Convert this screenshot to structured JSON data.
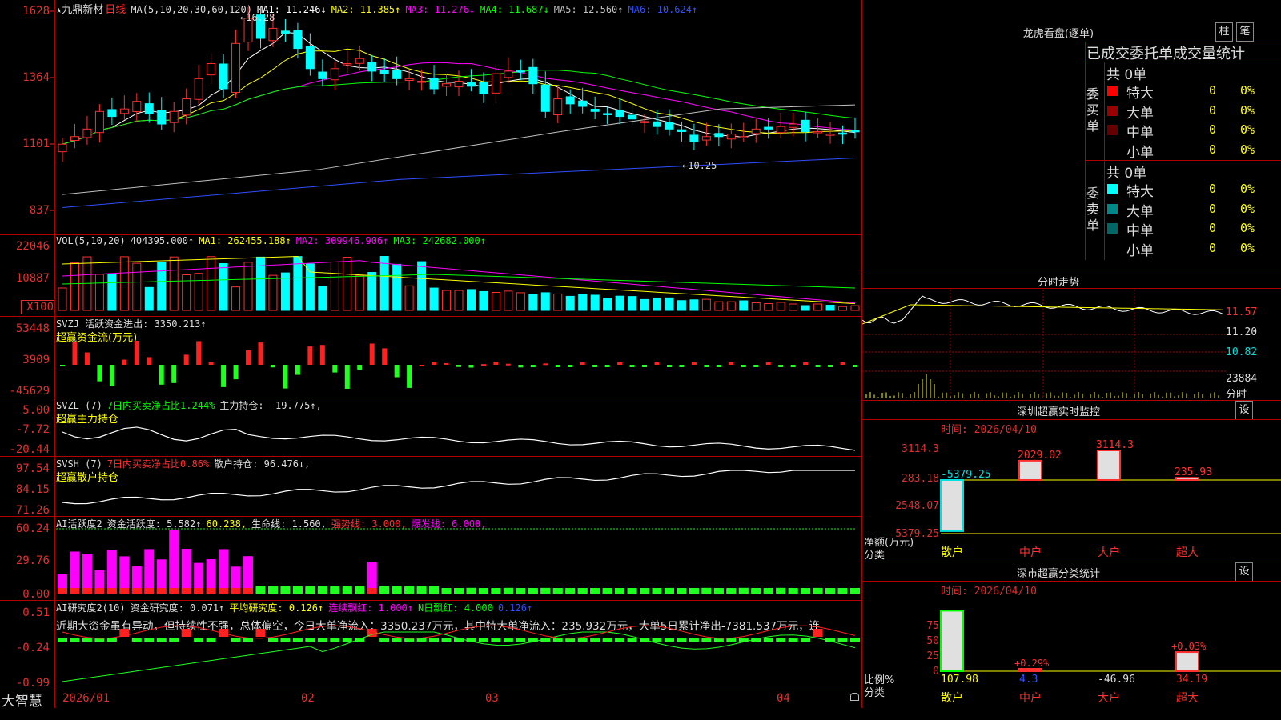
{
  "stock": {
    "name": "九鼎新材",
    "period": "日线"
  },
  "main_panel": {
    "ma_label": "MA(5,10,20,30,60,120)",
    "ma_values": [
      {
        "label": "MA1:",
        "value": "11.246↓",
        "color": "#ffffff"
      },
      {
        "label": "MA2:",
        "value": "11.385↑",
        "color": "#ffff00"
      },
      {
        "label": "MA3:",
        "value": "11.276↓",
        "color": "#ff00ff"
      },
      {
        "label": "MA4:",
        "value": "11.687↓",
        "color": "#00ff00"
      },
      {
        "label": "MA5:",
        "value": "12.560↑",
        "color": "#c0c0c0"
      },
      {
        "label": "MA6:",
        "value": "10.624↑",
        "color": "#2f4fff"
      }
    ],
    "y_ticks": [
      "1628",
      "1364",
      "1101",
      "837"
    ],
    "high_label": "16.28",
    "low_label": "10.25"
  },
  "vol_panel": {
    "label": "VOL(5,10,20)",
    "value": "404395.000↑",
    "ma1": "MA1: 262455.188↑",
    "ma2": "MA2: 309946.906↑",
    "ma3": "MA3: 242682.000↑",
    "y_ticks": [
      "22046",
      "10887",
      "X100"
    ]
  },
  "svzj_panel": {
    "label": "SVZJ  活跃资金进出: 3350.213↑",
    "sub": "超赢资金流(万元)",
    "y_ticks": [
      "53448",
      "3909",
      "-45629"
    ]
  },
  "svzl_panel": {
    "label": "SVZL (7)",
    "ratio": "7日内买卖净占比1.244%",
    "hold": "主力持仓: -19.775↑,",
    "sub": "超赢主力持仓",
    "y_ticks": [
      "5.00",
      "-7.72",
      "-20.44"
    ]
  },
  "svsh_panel": {
    "label": "SVSH (7)",
    "ratio": "7日内买卖净占比0.86%",
    "hold": "散户持仓: 96.476↓,",
    "sub": "超赢散户持仓",
    "y_ticks": [
      "97.54",
      "84.15",
      "71.26"
    ]
  },
  "ai1_panel": {
    "label": "AI活跃度2",
    "act": "资金活跃度: 5.582↑",
    "v2": "60.238,",
    "life": "生命线: 1.560,",
    "strong": "强势线: 3.000,",
    "burst": "爆发线: 6.000,",
    "y_ticks": [
      "60.24",
      "29.76",
      "0.00"
    ]
  },
  "ai2_panel": {
    "label": "AI研究度2(10)",
    "res": "资金研究度: 0.071↑",
    "avg": "平均研究度: 0.126↑",
    "cont": "连续飘红: 1.000↑",
    "nday": "N日飘红: 4.000",
    "last": "0.126↑",
    "text": "近期大资金虽有异动，但持续性不强，总体偏空，今日大单净流入：3350.237万元，其中特大单净流入：235.932万元，大单5日累计净出-7381.537万元，连",
    "y_ticks": [
      "0.51",
      "-0.24",
      "-0.99"
    ]
  },
  "x_axis": [
    "2026/01",
    "02",
    "03",
    "04"
  ],
  "brand": "大智慧",
  "right_panel": {
    "lhb_title": "龙虎看盘(逐单)",
    "btn1": "柱",
    "btn2": "笔",
    "sub_title": "已成交委托单成交量统计",
    "buy_label": "委买单",
    "sell_label": "委卖单",
    "buy_total": "共 0单",
    "sell_total": "共 0单",
    "buy_rows": [
      {
        "name": "特大",
        "val": "0",
        "pct": "0%",
        "color": "#ff0000"
      },
      {
        "name": "大单",
        "val": "0",
        "pct": "0%",
        "color": "#990000"
      },
      {
        "name": "中单",
        "val": "0",
        "pct": "0%",
        "color": "#660000"
      },
      {
        "name": "小单",
        "val": "0",
        "pct": "0%",
        "color": "#000000"
      }
    ],
    "sell_rows": [
      {
        "name": "特大",
        "val": "0",
        "pct": "0%",
        "color": "#00ffff"
      },
      {
        "name": "大单",
        "val": "0",
        "pct": "0%",
        "color": "#008888"
      },
      {
        "name": "中单",
        "val": "0",
        "pct": "0%",
        "color": "#006666"
      },
      {
        "name": "小单",
        "val": "0",
        "pct": "0%",
        "color": "#000000"
      }
    ],
    "fs_title": "分时走势",
    "fs_prices": [
      "11.57",
      "11.20",
      "10.82"
    ],
    "fs_vol": "23884",
    "fs_vol_label": "分时",
    "sz1_title": "深圳超赢实时监控",
    "set1": "设",
    "sz1_time": "时间: 2026/04/10",
    "sz1_y": [
      "3114.3",
      "283.18",
      "-2548.07",
      "-5379.25"
    ],
    "sz1_unit": "净额(万元)",
    "sz1_cat": "分类",
    "sz2_title": "深市超赢分类统计",
    "set2": "设",
    "sz2_time": "时间: 2026/04/10",
    "sz2_y": [
      "75",
      "50",
      "25",
      "0"
    ],
    "sz2_unit": "比例%",
    "sz2_cat": "分类",
    "cats": [
      "散户",
      "中户",
      "大户",
      "超大"
    ]
  },
  "chart_data": [
    {
      "type": "candlestick",
      "title": "九鼎新材 日线",
      "y_ticks": [
        16.28,
        13.64,
        11.01,
        8.37
      ],
      "high": 16.28,
      "low": 10.25,
      "close_approx": [
        11.0,
        11.3,
        11.6,
        12.3,
        12.1,
        12.4,
        12.7,
        12.2,
        11.8,
        12.3,
        12.8,
        13.6,
        14.2,
        13.2,
        15.0,
        16.0,
        15.2,
        15.6,
        15.4,
        14.8,
        14.0,
        13.6,
        14.0,
        14.2,
        14.4,
        13.9,
        13.8,
        13.6,
        13.6,
        13.5,
        13.2,
        13.4,
        13.5,
        13.3,
        13.0,
        13.8,
        13.9,
        13.9,
        13.4,
        12.3,
        12.8,
        12.6,
        12.5,
        12.3,
        12.2,
        12.1,
        12.0,
        11.9,
        11.7,
        11.6,
        11.5,
        11.1,
        11.3,
        11.3,
        11.4,
        11.3,
        11.6,
        11.6,
        11.7,
        11.8,
        11.5,
        11.5,
        11.4,
        11.4,
        11.5
      ]
    },
    {
      "type": "bar",
      "title": "VOL(5,10,20)",
      "y_ticks": [
        22046,
        10887
      ],
      "unit": "X100"
    },
    {
      "type": "bar",
      "title": "SVZJ 活跃资金进出",
      "y_ticks": [
        53448,
        3909,
        -45629
      ],
      "last": 3350.213
    },
    {
      "type": "line",
      "title": "SVZL 主力持仓",
      "y_ticks": [
        5.0,
        -7.72,
        -20.44
      ],
      "last": -19.775
    },
    {
      "type": "line",
      "title": "SVSH 散户持仓",
      "y_ticks": [
        97.54,
        84.15,
        71.26
      ],
      "last": 96.476
    },
    {
      "type": "bar",
      "title": "AI活跃度2",
      "y_ticks": [
        60.24,
        29.76,
        0.0
      ],
      "last": 5.582
    },
    {
      "type": "line",
      "title": "AI研究度2(10)",
      "y_ticks": [
        0.51,
        -0.24,
        -0.99
      ],
      "last": 0.071
    },
    {
      "type": "bar",
      "title": "深圳超赢实时监控",
      "categories": [
        "散户",
        "中户",
        "大户",
        "超大"
      ],
      "values": [
        -5379.25,
        2029.02,
        3114.3,
        235.93
      ]
    },
    {
      "type": "bar",
      "title": "深市超赢分类统计",
      "categories": [
        "散户",
        "中户",
        "大户",
        "超大"
      ],
      "values": [
        107.98,
        4.3,
        -46.96,
        34.19
      ],
      "bar_labels": [
        "",
        "+0.29%",
        "",
        "+0.03%"
      ]
    }
  ]
}
